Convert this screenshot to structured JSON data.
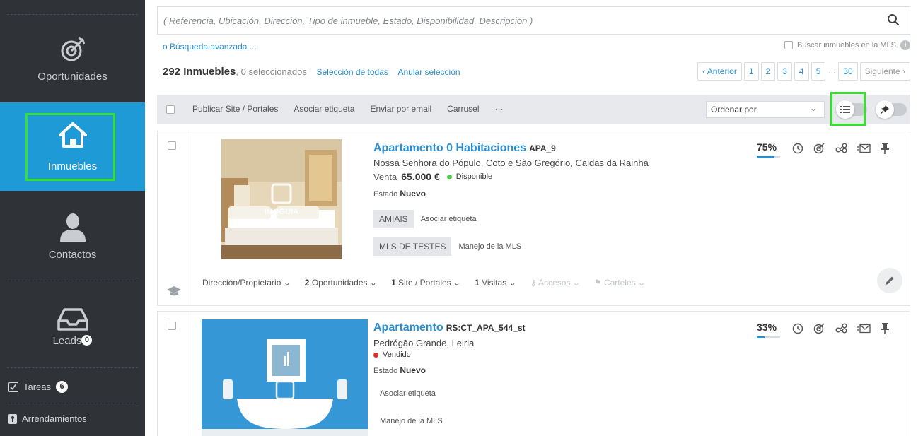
{
  "sidebar": {
    "items": [
      {
        "label": "Oportunidades",
        "icon": "target-icon"
      },
      {
        "label": "Inmuebles",
        "icon": "house-icon",
        "active": true
      },
      {
        "label": "Contactos",
        "icon": "person-icon"
      },
      {
        "label": "Leads",
        "icon": "inbox-icon",
        "badge": "0"
      }
    ],
    "small_items": [
      {
        "label": "Tareas",
        "icon": "checkbox-icon",
        "badge": "6"
      },
      {
        "label": "Arrendamientos",
        "icon": "lock-icon"
      }
    ]
  },
  "search": {
    "placeholder": "( Referencia, Ubicación, Dirección, Tipo de inmueble, Estado, Disponibilidad, Descripción )",
    "advanced_link": "o Búsqueda avanzada ...",
    "mls_label": "Buscar inmuebles en la MLS"
  },
  "summary": {
    "count": "292 Inmuebles",
    "selected": ", 0 seleccionados",
    "select_all": "Selección de todas",
    "clear_selection": "Anular selección"
  },
  "pager": {
    "prev": "‹ Anterior",
    "pages": [
      "1",
      "2",
      "3",
      "4",
      "5"
    ],
    "dots": "...",
    "last": "30",
    "next": "Siguiente ›"
  },
  "toolbar": {
    "actions": [
      "Publicar Site / Portales",
      "Asociar etiqueta",
      "Enviar por email",
      "Carrusel",
      "···"
    ],
    "sort_label": "Ordenar por"
  },
  "listings": [
    {
      "title": "Apartamento 0 Habitaciones",
      "ref": "APA_9",
      "address": "Nossa Senhora do Pópulo, Coto e São Gregório, Caldas da Rainha",
      "price_prefix": "Venta",
      "price": "65.000 €",
      "status": "Disponible",
      "status_color": "#4cc84c",
      "estado_label": "Estado",
      "estado_value": "Nuevo",
      "tag1": "AMIAIS",
      "tag1_link": "Asociar etiqueta",
      "tag2": "MLS DE TESTES",
      "tag2_link": "Manejo de la MLS",
      "percent": "75%",
      "percent_value": 75,
      "bottom": {
        "owner": "Dirección/Propietario",
        "opp_count": "2",
        "opp_label": "Oportunidades",
        "site_count": "1",
        "site_label": "Site / Portales",
        "visit_count": "1",
        "visit_label": "Visitas",
        "access_label": "Accesos",
        "signs_label": "Carteles"
      }
    },
    {
      "title": "Apartamento",
      "ref": "RS:CT_APA_544_st",
      "address": "Pedrógão Grande, Leiria",
      "status": "Vendido",
      "status_color": "#e0302a",
      "estado_label": "Estado",
      "estado_value": "Nuevo",
      "tag1_link": "Asociar etiqueta",
      "tag2_link": "Manejo de la MLS",
      "percent": "33%",
      "percent_value": 33
    }
  ],
  "colors": {
    "sidebar_bg": "#2f3338",
    "active_bg": "#1e9bd7",
    "accent": "#2a8dd0",
    "highlight": "#35e02f"
  }
}
